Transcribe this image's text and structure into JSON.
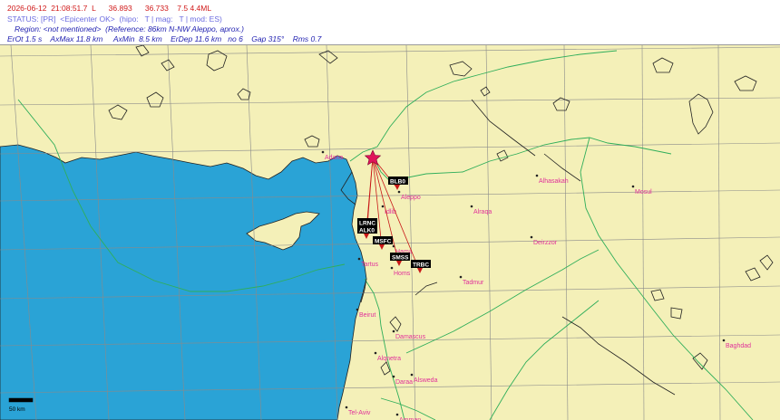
{
  "header": {
    "line1": "2026-06-12  21:08:51.7  L      36.893      36.733    7.5 4.4ML",
    "line2": "STATUS: [PR]  <Epicenter OK>  (hipo:   T | mag:   T | mod: ES)",
    "line3": "Region: <not mentioned>  (Reference: 86km N-NW Aleppo, aprox.)",
    "line4": "ErOt 1.5 s    AxMax 11.8 km     AxMin  8.5 km    ErDep 11.6 km   no 6    Gap 315°    Rms 0.7"
  },
  "cities": [
    {
      "name": "Adana"
    },
    {
      "name": "Aleppo"
    },
    {
      "name": "Idlib"
    },
    {
      "name": "Alraqa"
    },
    {
      "name": "Alhasakah"
    },
    {
      "name": "Mosul"
    },
    {
      "name": "Deirzzor"
    },
    {
      "name": "Hama"
    },
    {
      "name": "Homs"
    },
    {
      "name": "Tartus"
    },
    {
      "name": "Tadmur"
    },
    {
      "name": "Beirut"
    },
    {
      "name": "Damascus"
    },
    {
      "name": "Alqnetra"
    },
    {
      "name": "Alsweda"
    },
    {
      "name": "Daraa"
    },
    {
      "name": "Tel-Aviv"
    },
    {
      "name": "Amman"
    },
    {
      "name": "Baghdad"
    }
  ],
  "stations": [
    {
      "code": "BLB0"
    },
    {
      "code": "LRNC"
    },
    {
      "code": "ALK0"
    },
    {
      "code": "MSFC"
    },
    {
      "code": "SMSS"
    },
    {
      "code": "TRBC"
    }
  ],
  "scale": {
    "label": "50 km"
  },
  "colors": {
    "land": "#f4f0b8",
    "sea": "#2aa3d6",
    "border": "#2fae5a",
    "coast": "#222222",
    "city": "#e0309a",
    "epicenter": "#e0145a",
    "ray": "#c81818",
    "station_fill": "#000000"
  }
}
